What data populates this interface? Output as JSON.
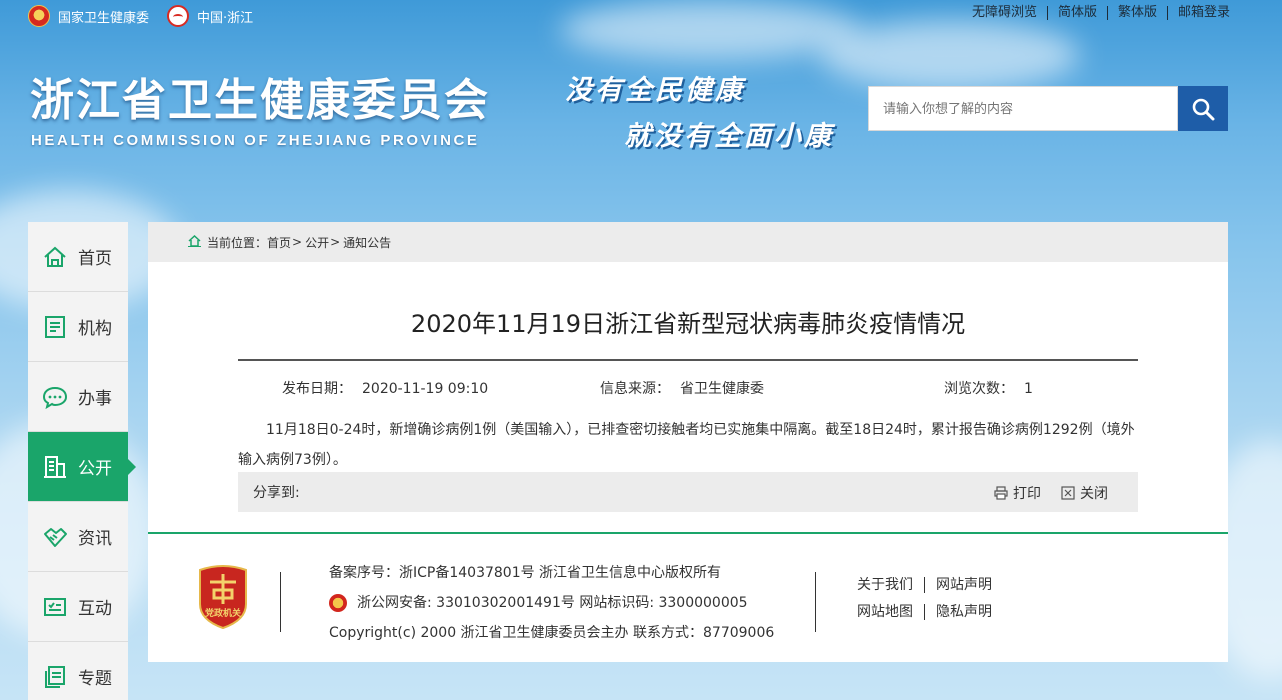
{
  "top_left": {
    "nhc_label": "国家卫生健康委",
    "zj_label": "中国·浙江"
  },
  "top_right": [
    "无障碍浏览",
    "简体版",
    "繁体版",
    "邮箱登录"
  ],
  "header": {
    "title": "浙江省卫生健康委员会",
    "subtitle": "HEALTH COMMISSION OF ZHEJIANG PROVINCE",
    "slogan_line1": "没有全民健康",
    "slogan_line2": "就没有全面小康"
  },
  "search": {
    "placeholder": "请输入你想了解的内容"
  },
  "sidenav": {
    "items": [
      {
        "label": "首页",
        "icon": "home-icon"
      },
      {
        "label": "机构",
        "icon": "document-icon"
      },
      {
        "label": "办事",
        "icon": "chat-icon"
      },
      {
        "label": "公开",
        "icon": "building-icon",
        "active": true
      },
      {
        "label": "资讯",
        "icon": "handshake-icon"
      },
      {
        "label": "互动",
        "icon": "board-icon"
      },
      {
        "label": "专题",
        "icon": "files-icon"
      }
    ]
  },
  "breadcrumb": {
    "prefix": "当前位置：",
    "items": [
      "首页",
      "公开",
      "通知公告"
    ],
    "separator": ">"
  },
  "article": {
    "title": "2020年11月19日浙江省新型冠状病毒肺炎疫情情况",
    "publish_label": "发布日期：",
    "publish_value": "2020-11-19 09:10",
    "source_label": "信息来源：",
    "source_value": "省卫生健康委",
    "views_label": "浏览次数：",
    "views_value": "1",
    "body": "11月18日0-24时，新增确诊病例1例（美国输入），已排查密切接触者均已实施集中隔离。截至18日24时，累计报告确诊病例1292例（境外输入病例73例）。"
  },
  "share": {
    "label": "分享到:",
    "print_label": "打印",
    "close_label": "关闭"
  },
  "footer": {
    "badge_text": "党政机关",
    "line1": "备案序号：浙ICP备14037801号   浙江省卫生信息中心版权所有",
    "line2": "浙公网安备: 33010302001491号  网站标识码: 3300000005",
    "line3": "Copyright(c) 2000 浙江省卫生健康委员会主办  联系方式：87709006",
    "links_row1": [
      "关于我们",
      "网站声明"
    ],
    "links_row2": [
      "网站地图",
      "隐私声明"
    ]
  },
  "colors": {
    "accent_green": "#1aa56a",
    "search_blue": "#1e5da8",
    "party_red": "#c8261f"
  }
}
